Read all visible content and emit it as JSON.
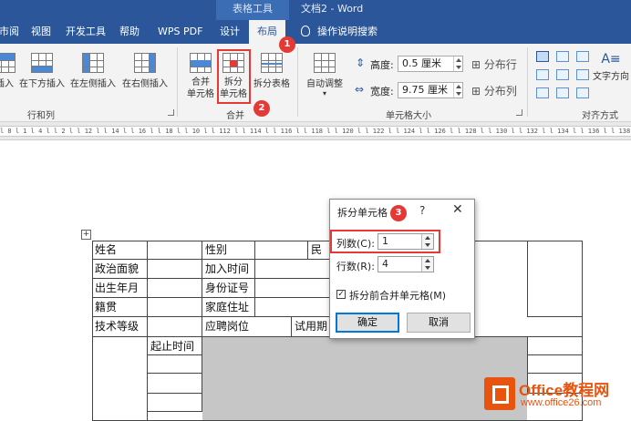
{
  "titlebar": {
    "context_tab": "表格工具",
    "document_title": "文档2  -  Word"
  },
  "tabs": [
    {
      "label": "审阅",
      "visible_text": "市阅"
    },
    {
      "label": "视图"
    },
    {
      "label": "开发工具"
    },
    {
      "label": "帮助"
    },
    {
      "label": "WPS PDF"
    },
    {
      "label": "设计"
    },
    {
      "label": "布局",
      "active": true
    }
  ],
  "tell_me": "操作说明搜索",
  "ribbon": {
    "rows_cols": {
      "insert_above_partial": "插入",
      "insert_below": "在下方插入",
      "insert_left": "在左侧插入",
      "insert_right": "在右侧插入",
      "label": "行和列"
    },
    "merge": {
      "merge_cells_line1": "合并",
      "merge_cells_line2": "单元格",
      "split_cells_line1": "拆分",
      "split_cells_line2": "单元格",
      "split_table": "拆分表格",
      "label": "合并"
    },
    "cell_size": {
      "autofit": "自动调整",
      "height_label": "高度:",
      "height_value": "0.5 厘米",
      "width_label": "宽度:",
      "width_value": "9.75 厘米",
      "distribute_rows": "分布行",
      "distribute_cols": "分布列",
      "label": "单元格大小"
    },
    "alignment": {
      "text_direction": "文字方向",
      "label": "对齐方式"
    }
  },
  "ruler_text": "l 8 l 1 l 4 l  l 2 l  l 12 l  l 14 l  l 16 l  l 18 l  l 10 l  l 112 l  l 114 l  l 116 l  l 118 l  l 120 l  l 122 l  l 124 l  l 126 l  l 128 l  l 130 l  l 132 l  l 134 l  l 136 l  l 138 l  l 140 l  l 142 l",
  "badges": [
    "1",
    "2",
    "3"
  ],
  "table": {
    "row1": [
      "姓名",
      "",
      "性别",
      "",
      "民"
    ],
    "row2": [
      "政治面貌",
      "",
      "加入时间"
    ],
    "row3": [
      "出生年月",
      "",
      "身份证号"
    ],
    "row4": [
      "籍贯",
      "",
      "家庭住址"
    ],
    "row5": [
      "技术等级",
      "",
      "应聘岗位",
      "试用期"
    ],
    "time_header": "起止时间"
  },
  "dialog": {
    "title": "拆分单元格",
    "help": "?",
    "close": "✕",
    "columns_label": "列数(C):",
    "columns_value": "1",
    "rows_label": "行数(R):",
    "rows_value": "4",
    "merge_before_split": "拆分前合并单元格(M)",
    "merge_before_split_checked": true,
    "ok": "确定",
    "cancel": "取消"
  },
  "watermark": {
    "brand": "Office教程网",
    "url": "www.office26.com"
  },
  "colors": {
    "word_blue": "#2b579a",
    "annotation_red": "#e53935",
    "watermark_orange": "#e8530e"
  }
}
